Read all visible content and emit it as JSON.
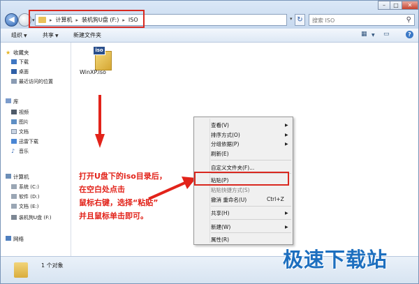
{
  "addressbar": {
    "crumbs": [
      "计算机",
      "装机狗U盘 (F:)",
      "ISO"
    ],
    "search_placeholder": "搜索 ISO"
  },
  "window_controls": {
    "minimize": "–",
    "maximize": "□",
    "close": "✕"
  },
  "toolbar": {
    "organize": "组织",
    "share": "共享",
    "new_folder": "新建文件夹"
  },
  "sidebar": {
    "favorites": {
      "label": "收藏夹",
      "items": [
        "下载",
        "桌面",
        "最近访问的位置"
      ]
    },
    "libraries": {
      "label": "库",
      "items": [
        "视频",
        "图片",
        "文档",
        "迅雷下载",
        "音乐"
      ]
    },
    "computer": {
      "label": "计算机",
      "items": [
        "系统 (C:)",
        "软件 (D:)",
        "文档 (E:)",
        "装机狗U盘 (F:)"
      ]
    },
    "network": {
      "label": "网络"
    }
  },
  "files": [
    {
      "name": "WinXP.iso",
      "badge": "iso"
    }
  ],
  "annotation": {
    "lines": [
      "打开U盘下的iso目录后，",
      "在空白处点击",
      "鼠标右键，选择“粘贴”",
      "并且鼠标单击即可。"
    ],
    "color": "#e2231a"
  },
  "context_menu": {
    "items": [
      {
        "label": "查看(V)",
        "submenu": true
      },
      {
        "label": "排序方式(O)",
        "submenu": true
      },
      {
        "label": "分组依据(P)",
        "submenu": true
      },
      {
        "label": "刷新(E)"
      },
      {
        "label": "自定义文件夹(F)..."
      },
      {
        "label": "粘贴(P)"
      },
      {
        "label": "粘贴快捷方式(S)",
        "disabled": true
      },
      {
        "label": "撤消 重命名(U)",
        "shortcut": "Ctrl+Z"
      },
      {
        "label": "共享(H)",
        "submenu": true
      },
      {
        "label": "新建(W)",
        "submenu": true
      },
      {
        "label": "属性(R)"
      }
    ]
  },
  "status": {
    "text": "1 个对象"
  },
  "watermark": "极速下载站",
  "colors": {
    "highlight": "#d9281f",
    "watermark": "#1d6fbf"
  }
}
